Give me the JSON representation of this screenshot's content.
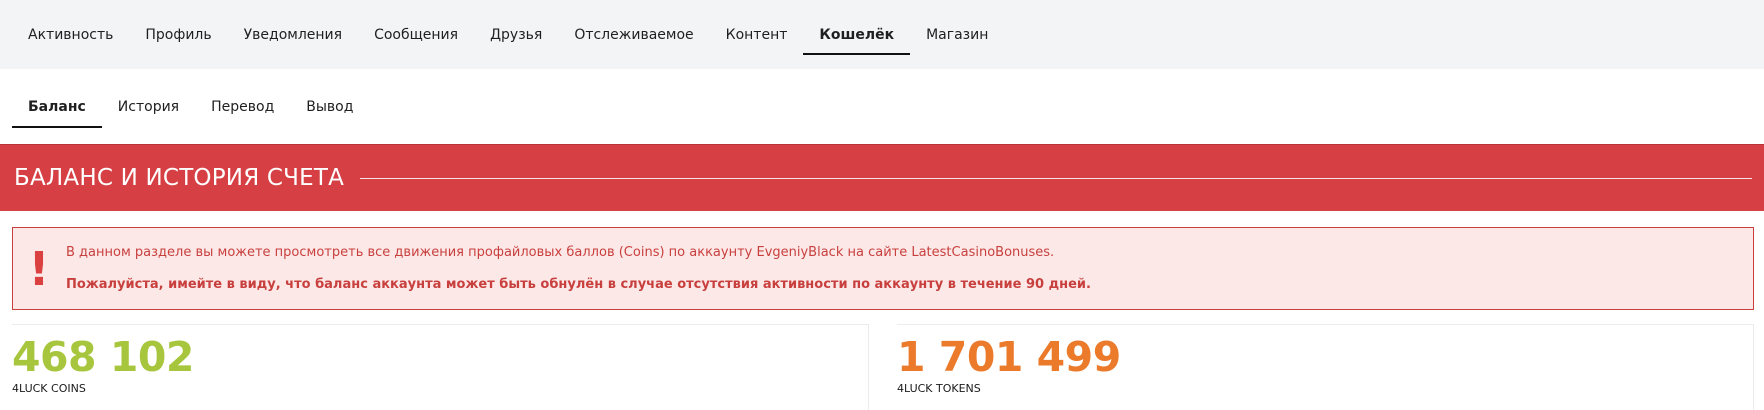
{
  "top_nav": {
    "items": [
      "Активность",
      "Профиль",
      "Уведомления",
      "Сообщения",
      "Друзья",
      "Отслеживаемое",
      "Контент",
      "Кошелёк",
      "Магазин"
    ]
  },
  "sub_nav": {
    "items": [
      "Баланс",
      "История",
      "Перевод",
      "Вывод"
    ]
  },
  "banner": {
    "title": "БАЛАНС И ИСТОРИЯ СЧЕТА"
  },
  "notice": {
    "icon": "exclamation-icon",
    "line1": "В данном разделе вы можете просмотреть все движения профайловых баллов (Coins) по аккаунту EvgeniyBlack на сайте LatestCasinoBonuses.",
    "line2": "Пожалуйста, имейте в виду, что баланс аккаунта может быть обнулён в случае отсутствия активности по аккаунту в течение 90 дней."
  },
  "stats": {
    "coins": {
      "value": "468 102",
      "label": "4LUCK COINS",
      "color": "#a8c63d"
    },
    "tokens": {
      "value": "1 701 499",
      "label": "4LUCK TOKENS",
      "color": "#eb7a2b"
    }
  },
  "colors": {
    "banner": "#d64044",
    "notice_bg": "#fde8e8",
    "notice_text": "#c8403e"
  }
}
